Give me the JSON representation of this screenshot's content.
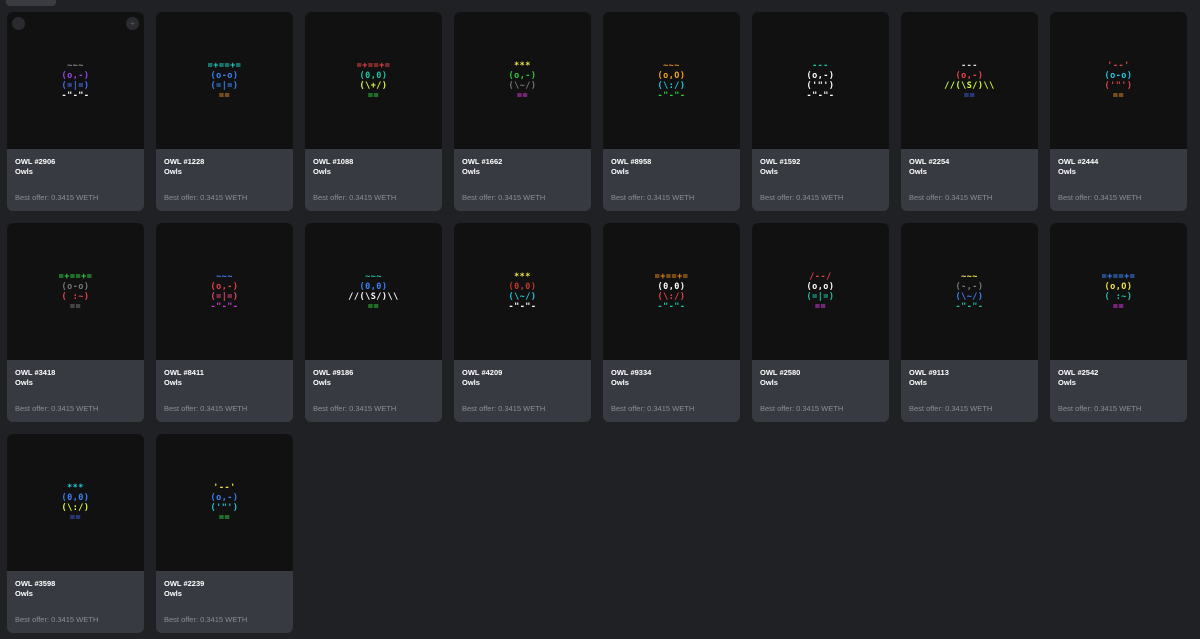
{
  "page": {
    "top_tab": ""
  },
  "cards": [
    {
      "title": "OWL #2906",
      "collection": "Owls",
      "offer": "Best offer: 0.3415 WETH",
      "show_controls": true,
      "art": [
        {
          "t": "~~~",
          "c": "#8a8a8a"
        },
        {
          "t": "(o,-)",
          "c": "#9b48e8"
        },
        {
          "t": "(=|=)",
          "c": "#4a6ff0"
        },
        {
          "t": "-\"-\"-",
          "c": "#ffffff"
        }
      ]
    },
    {
      "title": "OWL #1228",
      "collection": "Owls",
      "offer": "Best offer: 0.3415 WETH",
      "show_controls": false,
      "art": [
        {
          "t": "=+==+=",
          "c": "#1fd1c7"
        },
        {
          "t": "(o-o)",
          "c": "#3b82f6"
        },
        {
          "t": "(=|=)",
          "c": "#3b82f6"
        },
        {
          "t": "==",
          "c": "#e0861f"
        }
      ]
    },
    {
      "title": "OWL #1088",
      "collection": "Owls",
      "offer": "Best offer: 0.3415 WETH",
      "show_controls": false,
      "art": [
        {
          "t": "=+==+=",
          "c": "#e64545"
        },
        {
          "t": "(0,0)",
          "c": "#1fc4a3"
        },
        {
          "t": "(\\+/)",
          "c": "#d9ff3a"
        },
        {
          "t": "==",
          "c": "#2ecc40"
        }
      ]
    },
    {
      "title": "OWL #1662",
      "collection": "Owls",
      "offer": "Best offer: 0.3415 WETH",
      "show_controls": false,
      "art": [
        {
          "t": "***",
          "c": "#f5e642"
        },
        {
          "t": "(o,-)",
          "c": "#2ecc40"
        },
        {
          "t": "(\\~/)",
          "c": "#777777"
        },
        {
          "t": "==",
          "c": "#d63adb"
        }
      ]
    },
    {
      "title": "OWL #8958",
      "collection": "Owls",
      "offer": "Best offer: 0.3415 WETH",
      "show_controls": false,
      "art": [
        {
          "t": "~~~",
          "c": "#e0861f"
        },
        {
          "t": "(o,O)",
          "c": "#f5a623"
        },
        {
          "t": "(\\:/)",
          "c": "#1fc9e0"
        },
        {
          "t": "-\"-\"-",
          "c": "#2ecc40"
        }
      ]
    },
    {
      "title": "OWL #1592",
      "collection": "Owls",
      "offer": "Best offer: 0.3415 WETH",
      "show_controls": false,
      "art": [
        {
          "t": "---",
          "c": "#1fc4a3"
        },
        {
          "t": "(o,-)",
          "c": "#ffffff"
        },
        {
          "t": "('\"')",
          "c": "#ffffff"
        },
        {
          "t": "-\"-\"-",
          "c": "#ffffff"
        }
      ]
    },
    {
      "title": "OWL #2254",
      "collection": "Owls",
      "offer": "Best offer: 0.3415 WETH",
      "show_controls": false,
      "art": [
        {
          "t": "---",
          "c": "#e0e0e0"
        },
        {
          "t": "(o,-)",
          "c": "#e64545"
        },
        {
          "t": "//(\\S/)\\\\",
          "c": "#d9ff3a"
        },
        {
          "t": "==",
          "c": "#3b5bdb"
        }
      ]
    },
    {
      "title": "OWL #2444",
      "collection": "Owls",
      "offer": "Best offer: 0.3415 WETH",
      "show_controls": false,
      "art": [
        {
          "t": "'--'",
          "c": "#e64545"
        },
        {
          "t": "(o-o)",
          "c": "#1fc9e0"
        },
        {
          "t": "('\"')",
          "c": "#e64545"
        },
        {
          "t": "==",
          "c": "#e0861f"
        }
      ]
    },
    {
      "title": "OWL #3418",
      "collection": "Owls",
      "offer": "Best offer: 0.3415 WETH",
      "show_controls": false,
      "art": [
        {
          "t": "=+==+=",
          "c": "#2ecc40"
        },
        {
          "t": "(o-o)",
          "c": "#777777"
        },
        {
          "t": "( :~)",
          "c": "#e64545"
        },
        {
          "t": "==",
          "c": "#777777"
        }
      ]
    },
    {
      "title": "OWL #8411",
      "collection": "Owls",
      "offer": "Best offer: 0.3415 WETH",
      "show_controls": false,
      "art": [
        {
          "t": "~~~",
          "c": "#3b82f6"
        },
        {
          "t": "(o,-)",
          "c": "#e64545"
        },
        {
          "t": "(=|=)",
          "c": "#e6457a"
        },
        {
          "t": "-\"-\"-",
          "c": "#d63adb"
        }
      ]
    },
    {
      "title": "OWL #9186",
      "collection": "Owls",
      "offer": "Best offer: 0.3415 WETH",
      "show_controls": false,
      "art": [
        {
          "t": "~~~",
          "c": "#1fc4a3"
        },
        {
          "t": "(0,0)",
          "c": "#3b82f6"
        },
        {
          "t": "//(\\S/)\\\\",
          "c": "#ffffff"
        },
        {
          "t": "==",
          "c": "#2ecc40"
        }
      ]
    },
    {
      "title": "OWL #4209",
      "collection": "Owls",
      "offer": "Best offer: 0.3415 WETH",
      "show_controls": false,
      "art": [
        {
          "t": "***",
          "c": "#f5e642"
        },
        {
          "t": "(0,0)",
          "c": "#c0392b"
        },
        {
          "t": "(\\~/)",
          "c": "#1fc9e0"
        },
        {
          "t": "-\"-\"-",
          "c": "#ffffff"
        }
      ]
    },
    {
      "title": "OWL #9334",
      "collection": "Owls",
      "offer": "Best offer: 0.3415 WETH",
      "show_controls": false,
      "art": [
        {
          "t": "=+==+=",
          "c": "#e0861f"
        },
        {
          "t": "(0,0)",
          "c": "#ffffff"
        },
        {
          "t": "(\\:/)",
          "c": "#e64545"
        },
        {
          "t": "-\"-\"-",
          "c": "#1fc4a3"
        }
      ]
    },
    {
      "title": "OWL #2580",
      "collection": "Owls",
      "offer": "Best offer: 0.3415 WETH",
      "show_controls": false,
      "art": [
        {
          "t": "/--/",
          "c": "#e64545"
        },
        {
          "t": "(o,o)",
          "c": "#ffffff"
        },
        {
          "t": "(=|=)",
          "c": "#1fc4a3"
        },
        {
          "t": "==",
          "c": "#d63adb"
        }
      ]
    },
    {
      "title": "OWL #9113",
      "collection": "Owls",
      "offer": "Best offer: 0.3415 WETH",
      "show_controls": false,
      "art": [
        {
          "t": "~~~",
          "c": "#f5e642"
        },
        {
          "t": "(-,-)",
          "c": "#777777"
        },
        {
          "t": "(\\~/)",
          "c": "#3b82f6"
        },
        {
          "t": "-\"-\"-",
          "c": "#1fc4a3"
        }
      ]
    },
    {
      "title": "OWL #2542",
      "collection": "Owls",
      "offer": "Best offer: 0.3415 WETH",
      "show_controls": false,
      "art": [
        {
          "t": "=+==+=",
          "c": "#3b82f6"
        },
        {
          "t": "(o,O)",
          "c": "#f5e642"
        },
        {
          "t": "( :~)",
          "c": "#1fc4a3"
        },
        {
          "t": "==",
          "c": "#d63adb"
        }
      ]
    },
    {
      "title": "OWL #3598",
      "collection": "Owls",
      "offer": "Best offer: 0.3415 WETH",
      "show_controls": false,
      "art": [
        {
          "t": "***",
          "c": "#1fc9e0"
        },
        {
          "t": "(0,0)",
          "c": "#3b82f6"
        },
        {
          "t": "(\\:/)",
          "c": "#d9ff3a"
        },
        {
          "t": "==",
          "c": "#3b5bdb"
        }
      ]
    },
    {
      "title": "OWL #2239",
      "collection": "Owls",
      "offer": "Best offer: 0.3415 WETH",
      "show_controls": false,
      "art": [
        {
          "t": "'--'",
          "c": "#f5e642"
        },
        {
          "t": "(o,-)",
          "c": "#3b82f6"
        },
        {
          "t": "('\"')",
          "c": "#1fc9e0"
        },
        {
          "t": "==",
          "c": "#2ecc40"
        }
      ]
    }
  ],
  "icons": {
    "corner_left": "circle-button-icon",
    "corner_right": "plus-icon",
    "corner_right_glyph": "+"
  }
}
